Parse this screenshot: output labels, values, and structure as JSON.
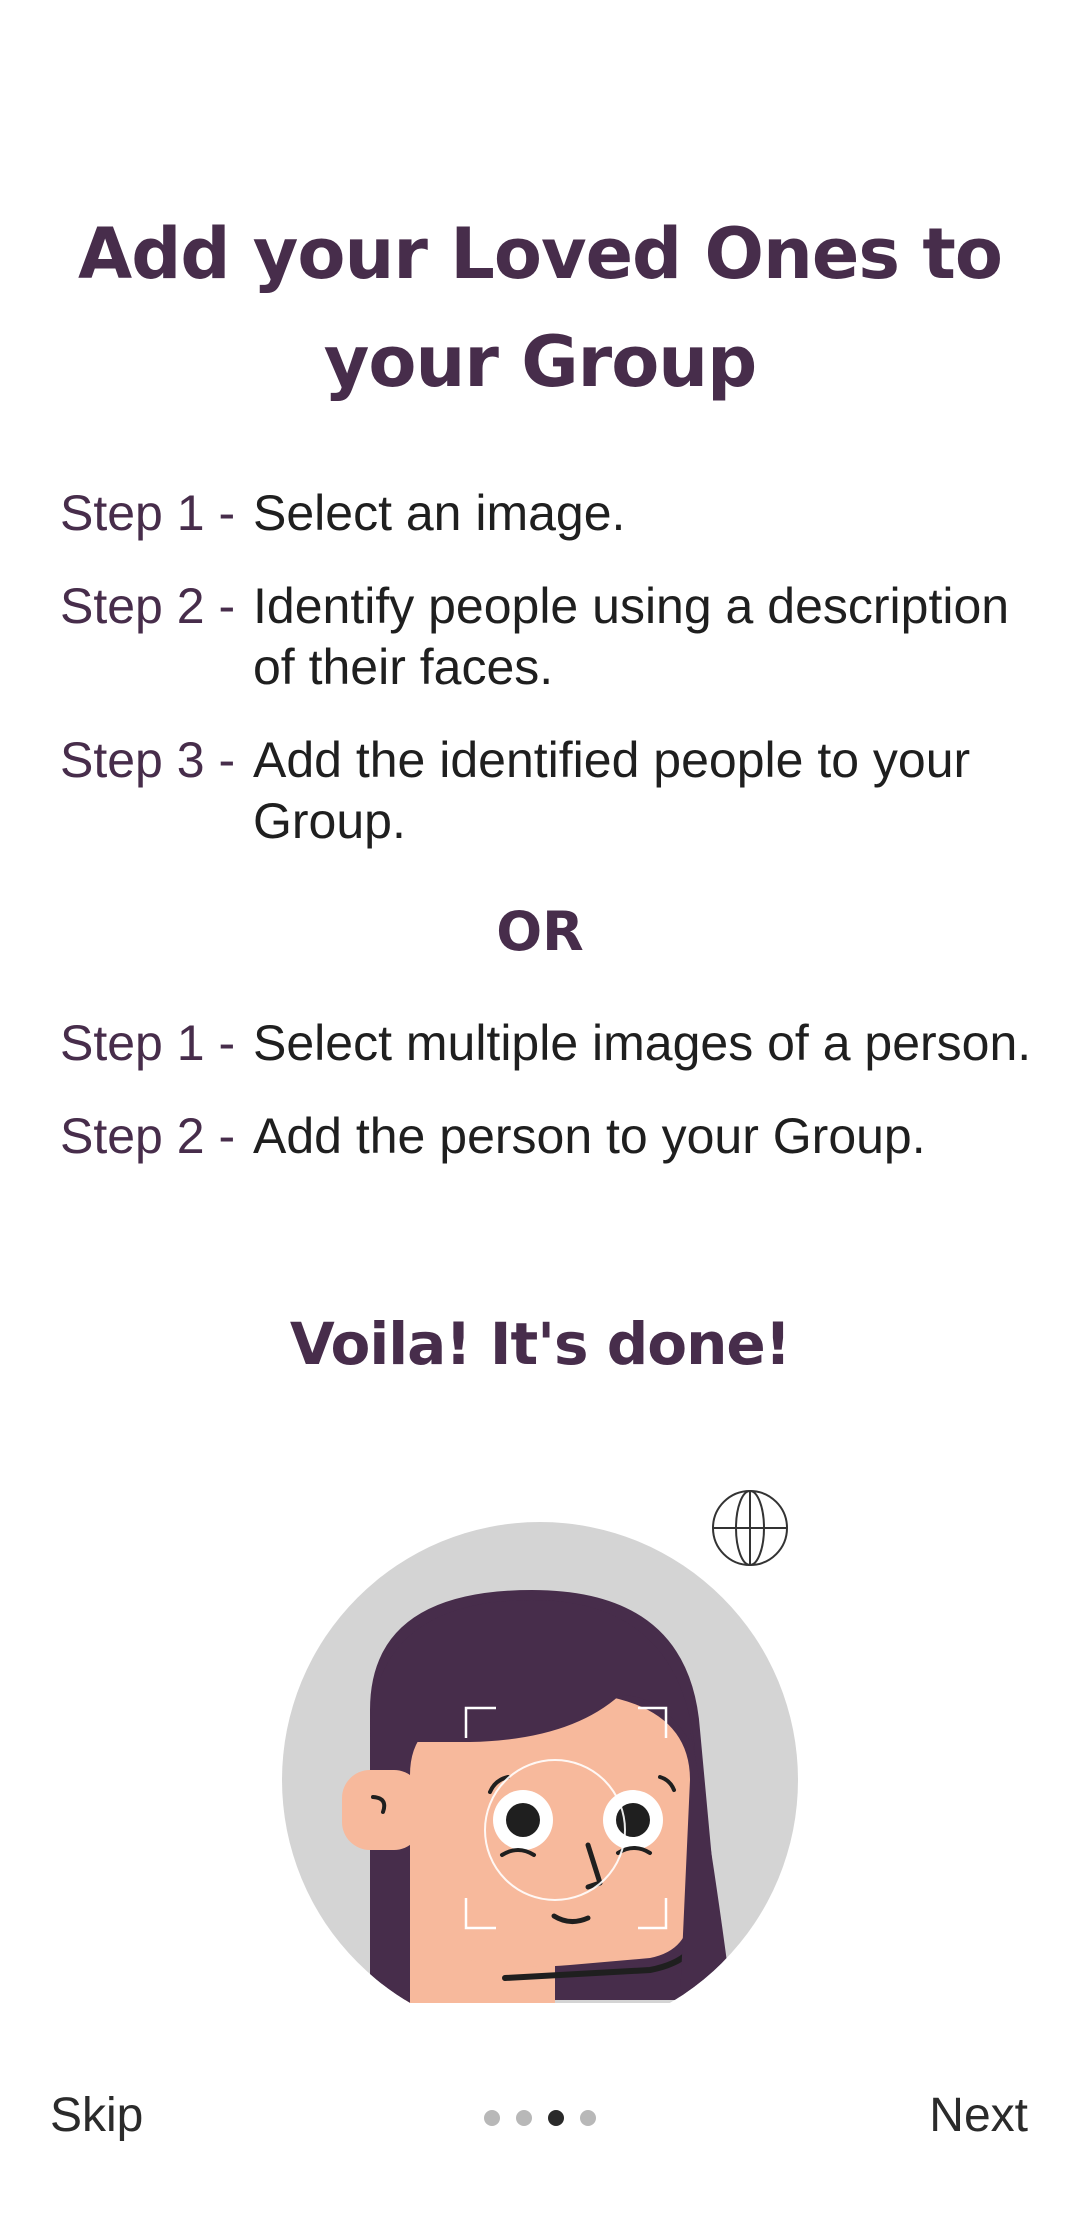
{
  "title": "Add your Loved Ones to your Group",
  "steps_a": [
    {
      "label": "Step 1 -",
      "text": "Select an image."
    },
    {
      "label": "Step 2 -",
      "text": "Identify people using a description of their faces."
    },
    {
      "label": "Step 3 -",
      "text": "Add the identified people to your Group."
    }
  ],
  "or_label": "OR",
  "steps_b": [
    {
      "label": "Step 1 -",
      "text": "Select multiple images of a person."
    },
    {
      "label": "Step 2 -",
      "text": "Add the person to your Group."
    }
  ],
  "done_label": "Voila! It's done!",
  "illustration": {
    "icon": "face-scan-illustration",
    "hair_color": "#472d4b",
    "skin_color": "#f7b99c",
    "circle_color": "#d4d4d4"
  },
  "footer": {
    "skip_label": "Skip",
    "next_label": "Next",
    "page_count": 4,
    "active_page": 3
  }
}
